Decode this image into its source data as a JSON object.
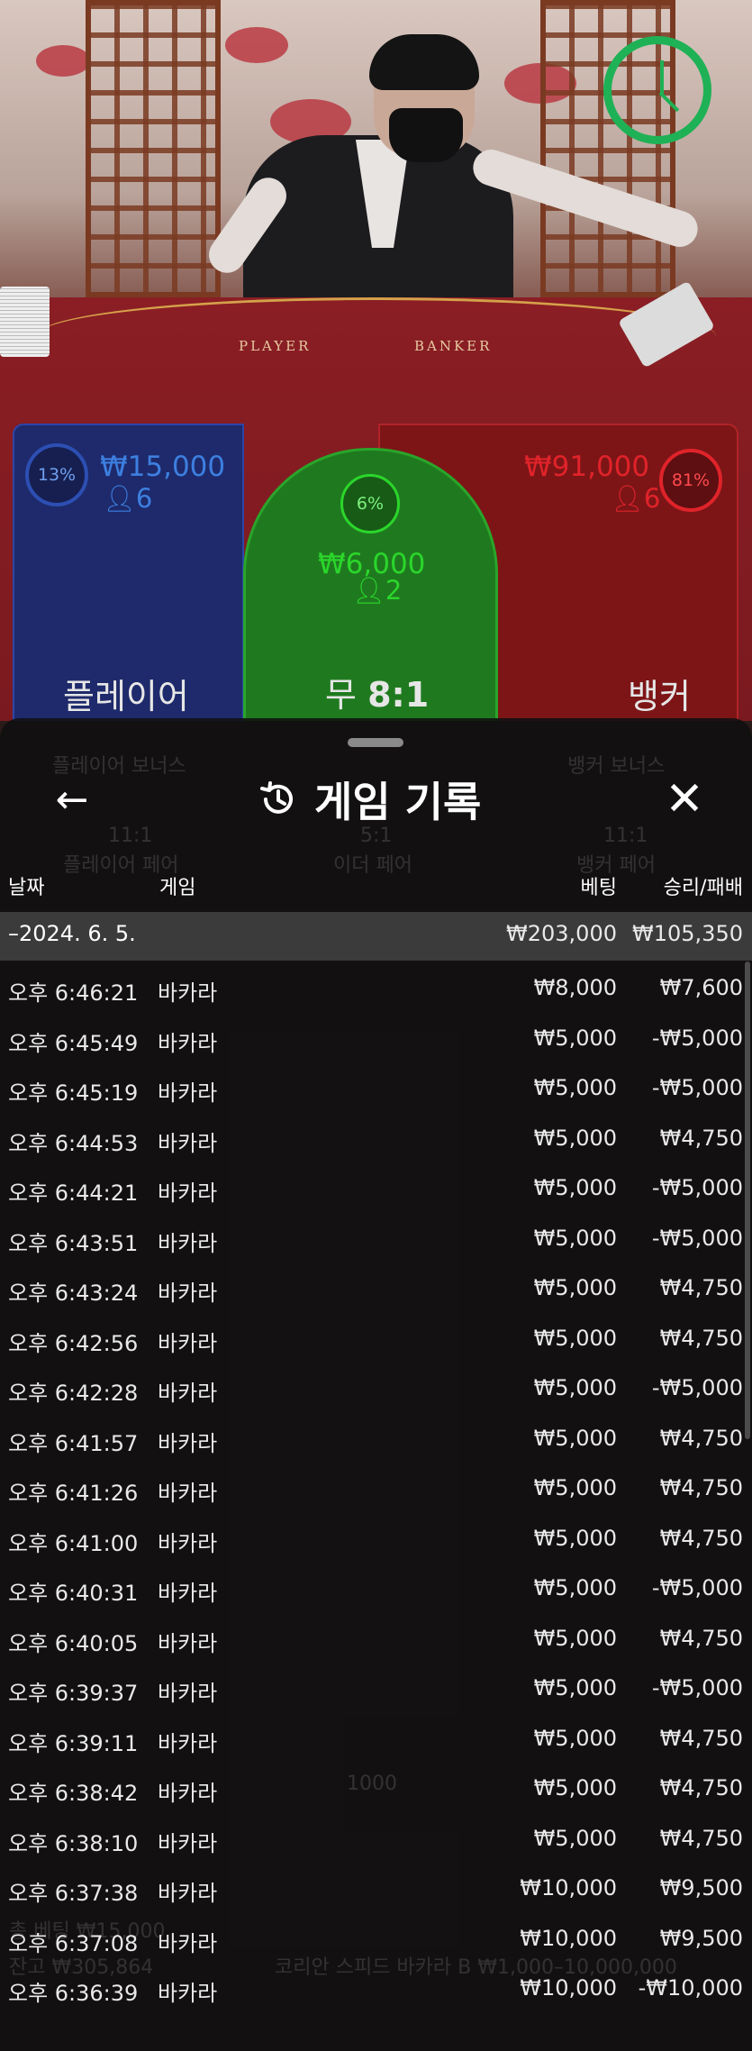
{
  "colors": {
    "player_blue": "#3d7fe0",
    "banker_red": "#e0232a",
    "tie_green": "#2bd62b",
    "timer_green": "#1fb155",
    "sheet_bg": "#101010",
    "date_row_bg": "#3b3b3b"
  },
  "video": {
    "table_left_text": "PLAYER",
    "table_right_text": "BANKER",
    "timer_icon": "clock-icon"
  },
  "bets": {
    "player": {
      "percent": "13%",
      "amount": "₩15,000",
      "count": "6",
      "label": "플레이어"
    },
    "tie": {
      "percent": "6%",
      "amount": "₩6,000",
      "count": "2",
      "label": "무",
      "odds": "8:1"
    },
    "banker": {
      "percent": "81%",
      "amount": "₩91,000",
      "count": "6",
      "label": "뱅커"
    }
  },
  "sheet": {
    "title": "게임 기록",
    "back_icon": "arrow-left-icon",
    "history_icon": "history-icon",
    "close_icon": "close-icon",
    "columns": {
      "date": "날짜",
      "game": "게임",
      "bet": "베팅",
      "winloss": "승리/패배"
    },
    "date_group": {
      "date": "–2024. 6. 5.",
      "bet": "₩203,000",
      "winloss": "₩105,350"
    },
    "rows": [
      {
        "time": "오후 6:46:21",
        "game": "바카라",
        "bet": "₩8,000",
        "winloss": "₩7,600"
      },
      {
        "time": "오후 6:45:49",
        "game": "바카라",
        "bet": "₩5,000",
        "winloss": "-₩5,000"
      },
      {
        "time": "오후 6:45:19",
        "game": "바카라",
        "bet": "₩5,000",
        "winloss": "-₩5,000"
      },
      {
        "time": "오후 6:44:53",
        "game": "바카라",
        "bet": "₩5,000",
        "winloss": "₩4,750"
      },
      {
        "time": "오후 6:44:21",
        "game": "바카라",
        "bet": "₩5,000",
        "winloss": "-₩5,000"
      },
      {
        "time": "오후 6:43:51",
        "game": "바카라",
        "bet": "₩5,000",
        "winloss": "-₩5,000"
      },
      {
        "time": "오후 6:43:24",
        "game": "바카라",
        "bet": "₩5,000",
        "winloss": "₩4,750"
      },
      {
        "time": "오후 6:42:56",
        "game": "바카라",
        "bet": "₩5,000",
        "winloss": "₩4,750"
      },
      {
        "time": "오후 6:42:28",
        "game": "바카라",
        "bet": "₩5,000",
        "winloss": "-₩5,000"
      },
      {
        "time": "오후 6:41:57",
        "game": "바카라",
        "bet": "₩5,000",
        "winloss": "₩4,750"
      },
      {
        "time": "오후 6:41:26",
        "game": "바카라",
        "bet": "₩5,000",
        "winloss": "₩4,750"
      },
      {
        "time": "오후 6:41:00",
        "game": "바카라",
        "bet": "₩5,000",
        "winloss": "₩4,750"
      },
      {
        "time": "오후 6:40:31",
        "game": "바카라",
        "bet": "₩5,000",
        "winloss": "-₩5,000"
      },
      {
        "time": "오후 6:40:05",
        "game": "바카라",
        "bet": "₩5,000",
        "winloss": "₩4,750"
      },
      {
        "time": "오후 6:39:37",
        "game": "바카라",
        "bet": "₩5,000",
        "winloss": "-₩5,000"
      },
      {
        "time": "오후 6:39:11",
        "game": "바카라",
        "bet": "₩5,000",
        "winloss": "₩4,750"
      },
      {
        "time": "오후 6:38:42",
        "game": "바카라",
        "bet": "₩5,000",
        "winloss": "₩4,750"
      },
      {
        "time": "오후 6:38:10",
        "game": "바카라",
        "bet": "₩5,000",
        "winloss": "₩4,750"
      },
      {
        "time": "오후 6:37:38",
        "game": "바카라",
        "bet": "₩10,000",
        "winloss": "₩9,500"
      },
      {
        "time": "오후 6:37:08",
        "game": "바카라",
        "bet": "₩10,000",
        "winloss": "₩9,500"
      },
      {
        "time": "오후 6:36:39",
        "game": "바카라",
        "bet": "₩10,000",
        "winloss": "-₩10,000"
      }
    ]
  },
  "background_ghost": {
    "player_bonus": "플레이어 보너스",
    "banker_bonus": "뱅커 보너스",
    "player_pair_odds": "11:1",
    "player_pair": "플레이어 페어",
    "either_pair_odds": "5:1",
    "either_pair": "이더 페어",
    "banker_pair_odds": "11:1",
    "banker_pair": "뱅커 페어",
    "chip_value": "1000",
    "balance": "잔고 ₩305,864",
    "total_bet": "총 베팅 ₩15,000",
    "table_info": "코리안 스피드 바카라 B ₩1,000–10,000,000"
  }
}
